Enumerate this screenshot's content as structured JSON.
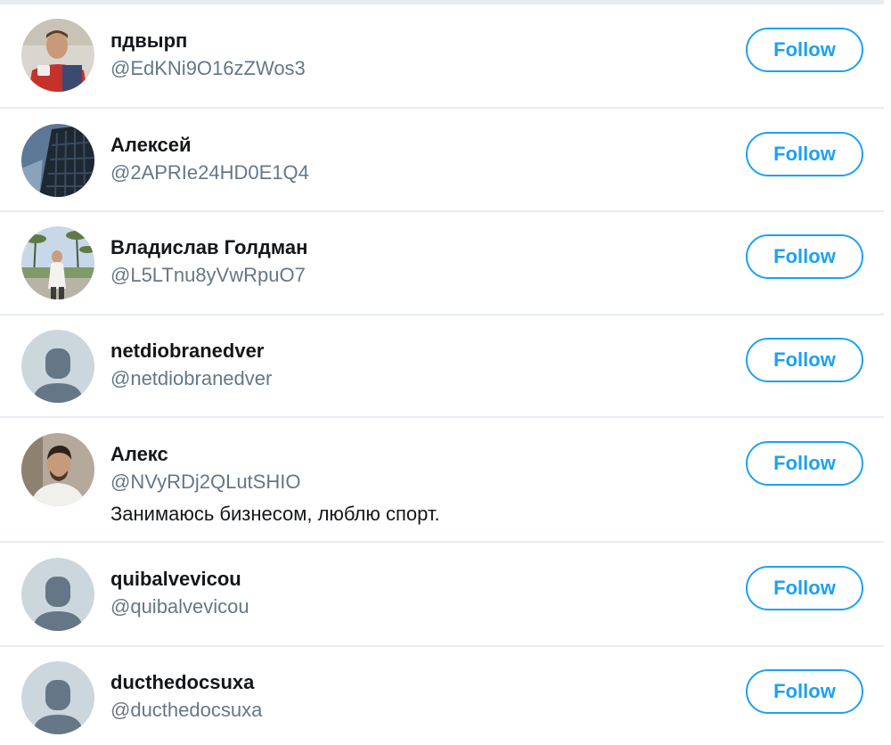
{
  "follow_button_label": "Follow",
  "colors": {
    "accent": "#1da1f2",
    "name_text": "#14171a",
    "handle_text": "#657786",
    "divider": "#e6ecf0",
    "default_avatar_bg": "#ccd6dd",
    "default_avatar_figure": "#657786"
  },
  "users": [
    {
      "name": "пдвырп",
      "handle": "@EdKNi9O16zZWos3",
      "bio": "",
      "avatar": "photo-man-red-sweater"
    },
    {
      "name": "Алексей",
      "handle": "@2APRIe24HD0E1Q4",
      "bio": "",
      "avatar": "photo-building"
    },
    {
      "name": "Владислав Голдман",
      "handle": "@L5LTnu8yVwRpuO7",
      "bio": "",
      "avatar": "photo-palm-trees"
    },
    {
      "name": "netdiobranedver",
      "handle": "@netdiobranedver",
      "bio": "",
      "avatar": "default-profile-icon"
    },
    {
      "name": "Алекс",
      "handle": "@NVyRDj2QLutSHIO",
      "bio": "Занимаюсь бизнесом, люблю спорт.",
      "avatar": "photo-man-portrait"
    },
    {
      "name": "quibalvevicou",
      "handle": "@quibalvevicou",
      "bio": "",
      "avatar": "default-profile-icon"
    },
    {
      "name": "ducthedocsuxa",
      "handle": "@ducthedocsuxa",
      "bio": "",
      "avatar": "default-profile-icon"
    }
  ]
}
